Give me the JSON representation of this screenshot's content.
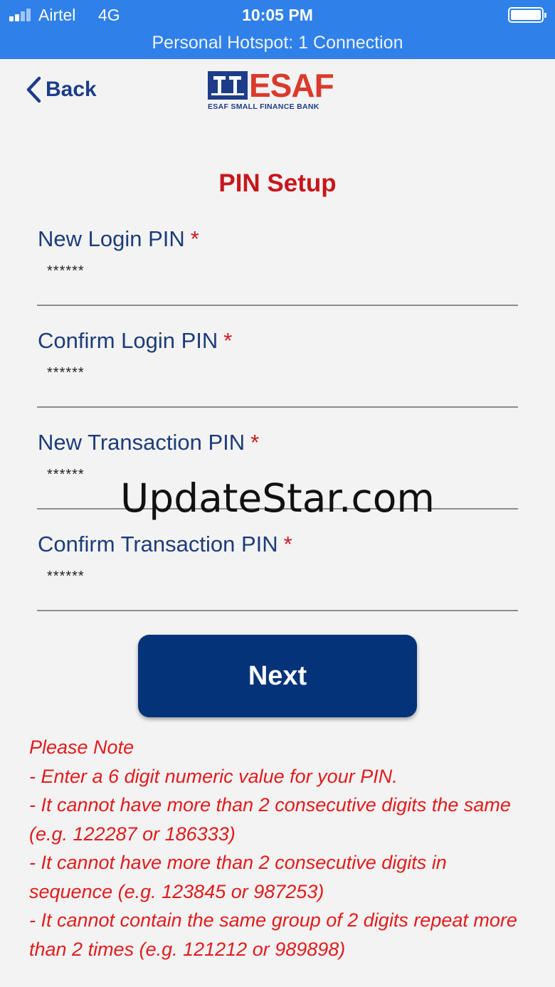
{
  "status_bar": {
    "carrier": "Airtel",
    "network": "4G",
    "time": "10:05 PM",
    "hotspot": "Personal Hotspot: 1 Connection",
    "signal_bars": 4
  },
  "header": {
    "back_label": "Back",
    "logo_text": "ESAF",
    "logo_subtext": "ESAF SMALL FINANCE BANK"
  },
  "page_title": "PIN Setup",
  "fields": [
    {
      "label": "New Login PIN",
      "required_mark": "*",
      "value": "******"
    },
    {
      "label": "Confirm Login PIN",
      "required_mark": "*",
      "value": "******"
    },
    {
      "label": "New Transaction PIN",
      "required_mark": "*",
      "value": "******"
    },
    {
      "label": "Confirm Transaction PIN",
      "required_mark": "*",
      "value": "******"
    }
  ],
  "next_button": "Next",
  "note": {
    "heading": "Please Note",
    "lines": [
      "- Enter a 6 digit numeric value for your PIN.",
      "- It cannot have more than 2 consecutive digits the same (e.g. 122287 or 186333)",
      "- It cannot have more than 2 consecutive digits in sequence (e.g. 123845 or 987253)",
      "- It cannot contain the same group of 2 digits repeat more than 2 times (e.g. 121212 or 989898)"
    ]
  },
  "watermark": "UpdateStar.com",
  "colors": {
    "status_bar": "#2f80e8",
    "primary_blue": "#04337a",
    "title_red": "#c8161d",
    "note_red": "#e21c1c",
    "label_blue": "#1d3d7a",
    "background": "#f3f3f3"
  }
}
